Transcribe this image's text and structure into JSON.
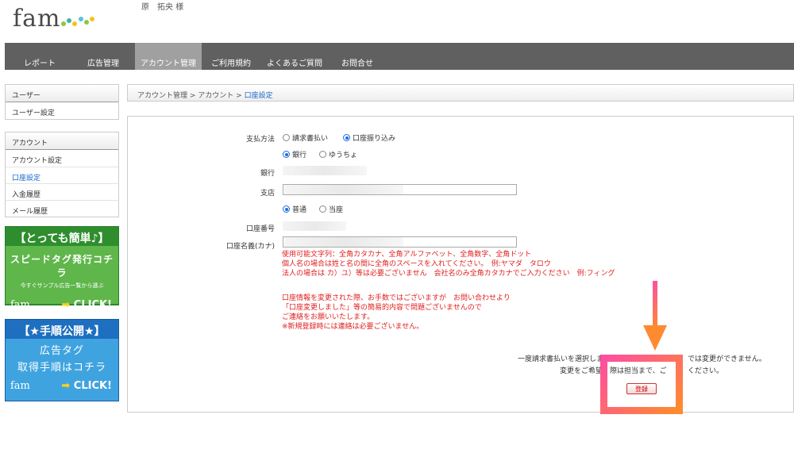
{
  "header": {
    "logo_text": "fam",
    "username": "原　拓央 様"
  },
  "nav": {
    "items": [
      {
        "label": "レポート"
      },
      {
        "label": "広告管理"
      },
      {
        "label": "アカウント管理",
        "active": true
      },
      {
        "label": "ご利用規約"
      },
      {
        "label": "よくあるご質問"
      },
      {
        "label": "お問合せ"
      }
    ]
  },
  "sidebar": {
    "user_section": {
      "title": "ユーザー",
      "items": [
        "ユーザー設定"
      ]
    },
    "account_section": {
      "title": "アカウント",
      "items": [
        "アカウント設定",
        "口座設定",
        "入金履歴",
        "メール履歴"
      ],
      "active_item": "口座設定"
    }
  },
  "banners": {
    "banner1": {
      "title": "【とっても簡単♪】",
      "line1": "スピードタグ発行コチラ",
      "line2": "今すぐサンプル広告一覧から選ぶ",
      "click": "CLICK!"
    },
    "banner2": {
      "title": "【★手順公開★】",
      "line1": "広告タグ",
      "line2": "取得手順はコチラ",
      "click": "CLICK!"
    }
  },
  "breadcrumb": {
    "part1": "アカウント管理",
    "sep": " > ",
    "part2": "アカウント",
    "current": "口座設定"
  },
  "form": {
    "payment_method_label": "支払方法",
    "payment_options": [
      "請求書払い",
      "口座振り込み"
    ],
    "bank_type_options": [
      "銀行",
      "ゆうちょ"
    ],
    "bank_label": "銀行",
    "branch_label": "支店",
    "account_type_options": [
      "普通",
      "当座"
    ],
    "account_number_label": "口座番号",
    "account_name_label": "口座名義(カナ)",
    "notes_red": [
      "使用可能文字列：全角カタカナ、全角アルファベット、全角数字、全角ドット",
      "個人名の場合は姓と名の間に全角のスペースを入れてください。　例:ヤマダ　タロウ",
      "法人の場合は カ）ユ）等は必要ございません　会社名のみ全角カタカナでご入力ください　例:フィング"
    ],
    "notes_red2": [
      "口座情報を変更された際、お手数ではございますが　お問い合わせより",
      "「口座変更しました」等の簡易的内容で問題ございませんので",
      "ご連絡をお願いいたします。",
      "※新規登録時には連絡は必要ございません。"
    ],
    "info_line1_left": "一度請求書払いを選択しま",
    "info_line1_right": "では変更ができません。",
    "info_line2_left": "変更をご希望",
    "info_line2_mid": "際は担当まで、ご",
    "info_line2_right": "ください。",
    "submit_label": "登録"
  },
  "colors": {
    "nav_bg": "#606060",
    "link_blue": "#1a66cc",
    "note_red": "#e02020",
    "highlight_pink": "#ff4fa0",
    "highlight_orange": "#ff8a30"
  }
}
